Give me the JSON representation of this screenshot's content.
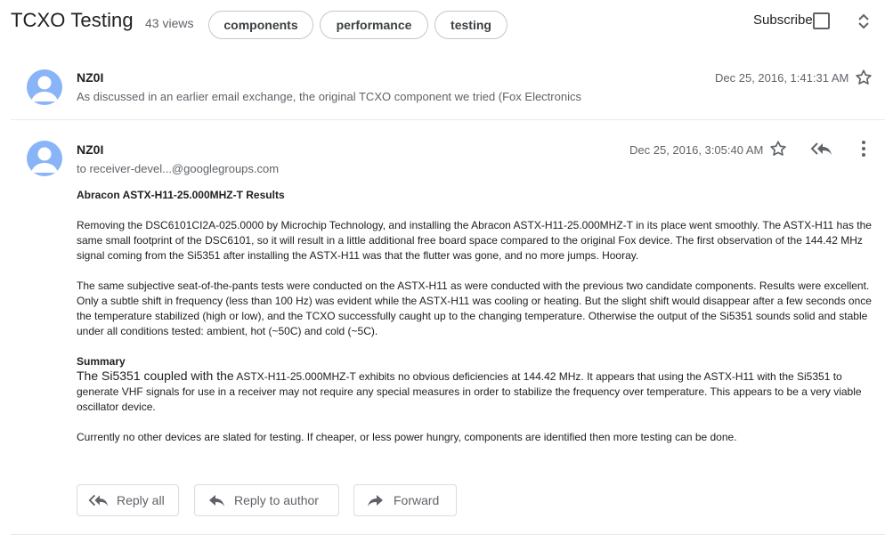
{
  "thread": {
    "title": "TCXO Testing",
    "views": "43 views",
    "tags": [
      "components",
      "performance",
      "testing"
    ],
    "subscribe_label": "Subscribe"
  },
  "messages": [
    {
      "author": "NZ0I",
      "date": "Dec 25, 2016, 1:41:31 AM",
      "snippet": "As discussed in an earlier email exchange, the original TCXO component we tried (Fox Electronics"
    },
    {
      "author": "NZ0I",
      "date": "Dec 25, 2016, 3:05:40 AM",
      "to": "to receiver-devel...@googlegroups.com",
      "heading": "Abracon ASTX-H11-25.000MHZ-T Results",
      "para1": "Removing the DSC6101CI2A-025.0000 by Microchip Technology, and installing the Abracon ASTX-H11-25.000MHZ-T in its place went smoothly. The ASTX-H11 has the same small footprint of the DSC6101, so it will result in a little additional free board space compared to the original Fox device. The first observation of the 144.42 MHz signal coming from the Si5351 after installing the ASTX-H11 was that the flutter was gone, and no more jumps. Hooray.",
      "para2": "The same subjective seat-of-the-pants tests were conducted on the ASTX-H11 as were conducted with the previous two candidate components. Results were excellent. Only a subtle shift in frequency (less than 100 Hz) was evident while the ASTX-H11 was cooling or heating. But the slight shift would disappear after a few seconds once the temperature stabilized (high or low), and the TCXO successfully caught up to the changing temperature. Otherwise the output of the Si5351 sounds solid and stable under all conditions tested: ambient, hot (~50C) and cold (~5C).",
      "summary_heading": "Summary",
      "summary_lead": "The Si5351 coupled with the",
      "summary_rest": " ASTX-H11-25.000MHZ-T exhibits no obvious deficiencies at 144.42 MHz. It appears that using the ASTX-H11 with the Si5351 to generate VHF signals for use in a receiver may not require any special measures in order to stabilize the frequency over temperature. This appears to be a very viable oscillator device.",
      "para3": "Currently no other devices are slated for testing. If cheaper, or less power hungry, components are identified then more testing can be done."
    }
  ],
  "actions": {
    "reply_all": "Reply all",
    "reply_author": "Reply to author",
    "forward": "Forward"
  }
}
